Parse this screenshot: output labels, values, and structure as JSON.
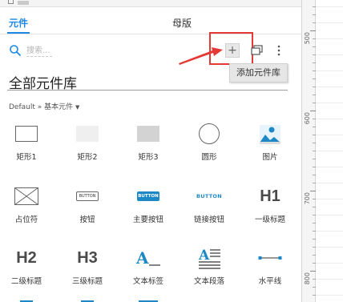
{
  "tabs": [
    {
      "label": "元件",
      "active": true
    },
    {
      "label": "母版",
      "active": false
    }
  ],
  "search": {
    "placeholder": "搜索..."
  },
  "toolbar": {
    "add_label": "+",
    "tooltip": "添加元件库"
  },
  "library": {
    "title": "全部元件库",
    "breadcrumb": "Default » 基本元件",
    "breadcrumb_caret": "▼"
  },
  "widgets": [
    {
      "label": "矩形1",
      "icon": "rectangle-outline-icon"
    },
    {
      "label": "矩形2",
      "icon": "rectangle-light-icon"
    },
    {
      "label": "矩形3",
      "icon": "rectangle-gray-icon"
    },
    {
      "label": "圆形",
      "icon": "circle-icon"
    },
    {
      "label": "图片",
      "icon": "image-icon"
    },
    {
      "label": "占位符",
      "icon": "placeholder-icon"
    },
    {
      "label": "按钮",
      "icon": "button-icon",
      "glyph": "BUTTON"
    },
    {
      "label": "主要按钮",
      "icon": "primary-button-icon",
      "glyph": "BUTTON"
    },
    {
      "label": "链接按钮",
      "icon": "link-button-icon",
      "glyph": "BUTTON"
    },
    {
      "label": "一级标题",
      "icon": "heading1-icon",
      "glyph": "H1"
    },
    {
      "label": "二级标题",
      "icon": "heading2-icon",
      "glyph": "H2"
    },
    {
      "label": "三级标题",
      "icon": "heading3-icon",
      "glyph": "H3"
    },
    {
      "label": "文本标签",
      "icon": "text-label-icon",
      "glyph": "A"
    },
    {
      "label": "文本段落",
      "icon": "text-paragraph-icon",
      "glyph": "A"
    },
    {
      "label": "水平线",
      "icon": "horizontal-line-icon"
    }
  ],
  "ruler": {
    "labels": [
      "500",
      "600",
      "700",
      "800"
    ]
  },
  "colors": {
    "accent": "#1e88e5",
    "highlight": "#e53935",
    "primary_button": "#1e88c7"
  }
}
